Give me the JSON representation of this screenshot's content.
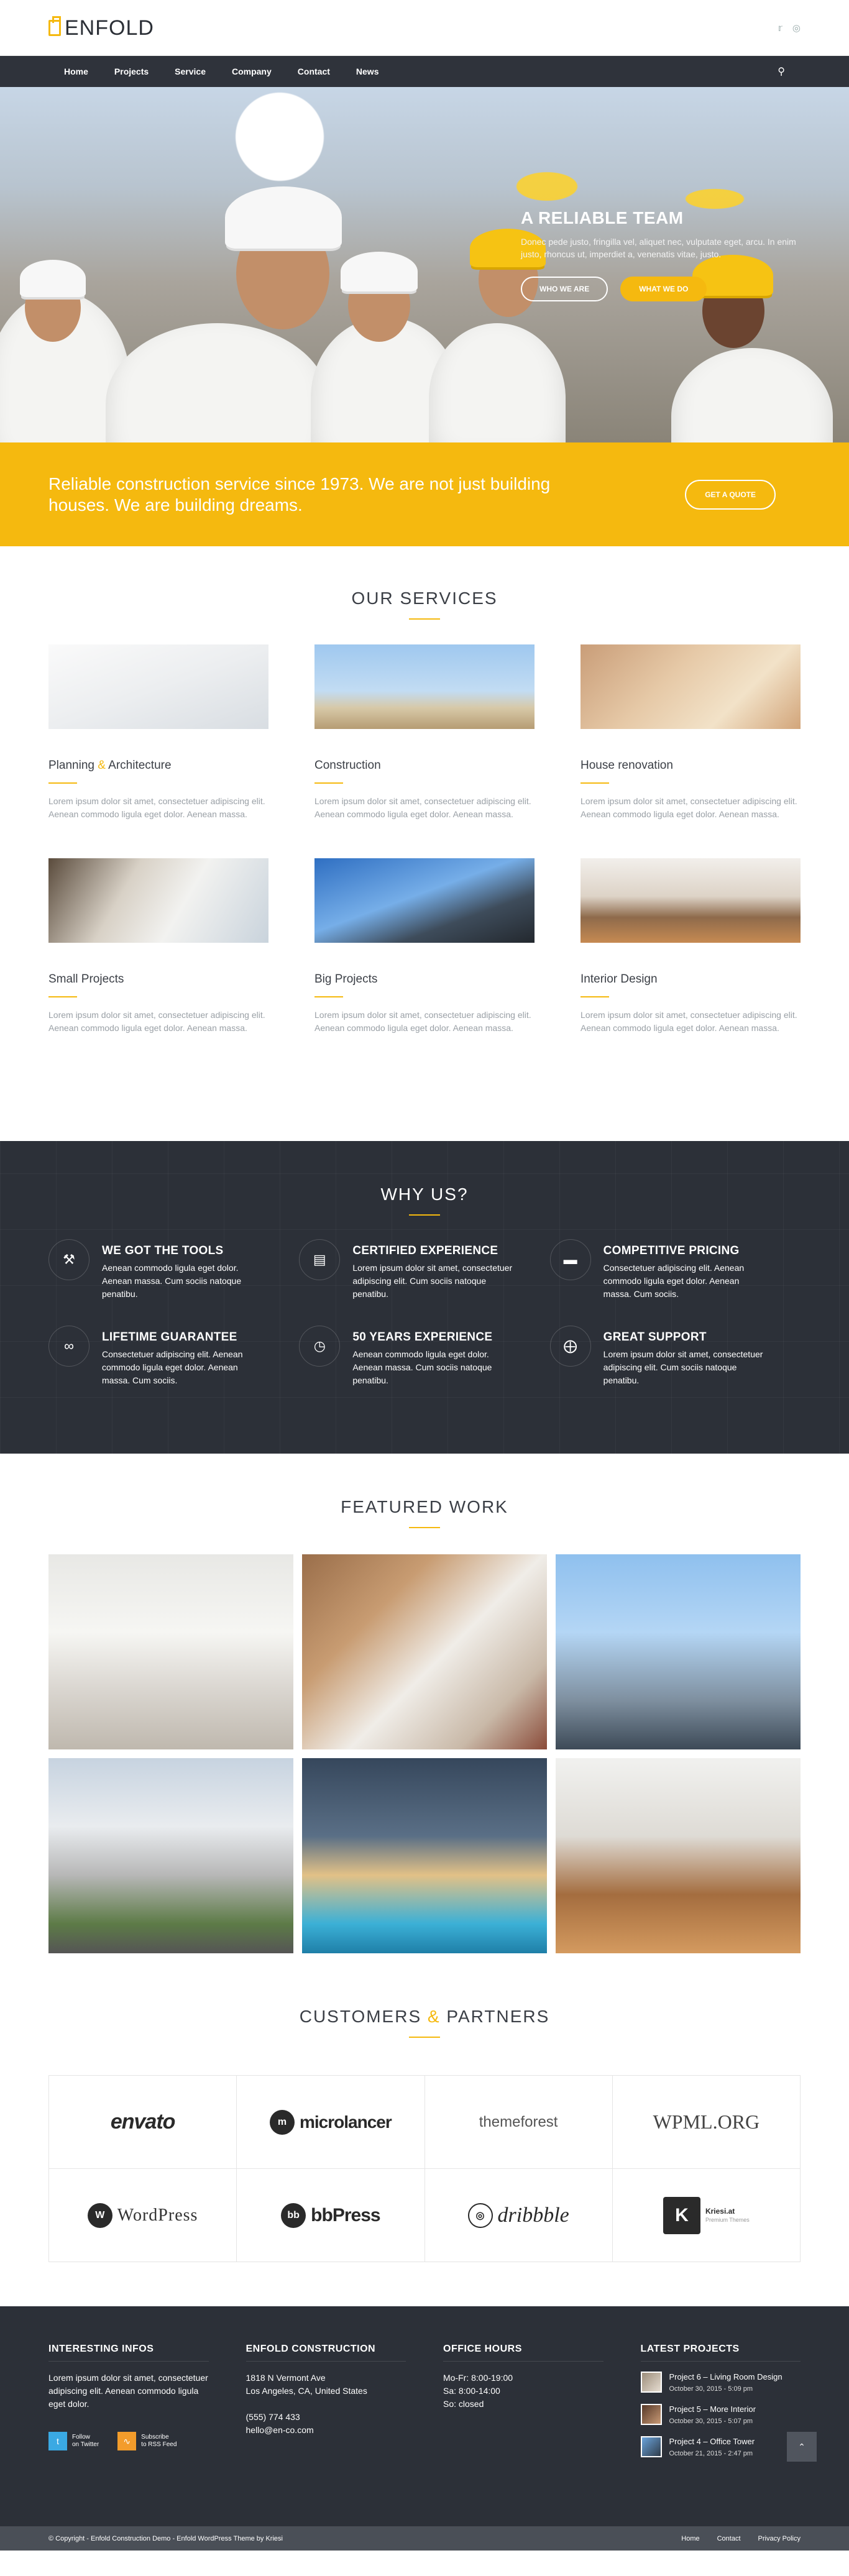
{
  "brand": {
    "name": "ENFOLD"
  },
  "header": {
    "social": [
      "twitter-icon",
      "dribbble-icon"
    ]
  },
  "nav": {
    "items": [
      "Home",
      "Projects",
      "Service",
      "Company",
      "Contact",
      "News"
    ],
    "search_icon": "search-icon"
  },
  "hero": {
    "title": "A RELIABLE TEAM",
    "text": "Donec pede justo, fringilla vel, aliquet nec, vulputate eget, arcu. In enim justo, rhoncus ut, imperdiet a, venenatis vitae, justo.",
    "btn_primary": "WHO WE ARE",
    "btn_secondary": "WHAT WE DO"
  },
  "banner": {
    "text": "Reliable construction service since 1973. We are not just building houses. We are building dreams.",
    "button": "GET A QUOTE"
  },
  "services": {
    "title": "OUR SERVICES",
    "items": [
      {
        "title_a": "Planning",
        "amp": "&",
        "title_b": "Architecture",
        "text": "Lorem ipsum dolor sit amet, consectetuer adipiscing elit. Aenean commodo ligula eget dolor. Aenean massa."
      },
      {
        "title": "Construction",
        "text": "Lorem ipsum dolor sit amet, consectetuer adipiscing elit. Aenean commodo ligula eget dolor. Aenean massa."
      },
      {
        "title": "House renovation",
        "text": "Lorem ipsum dolor sit amet, consectetuer adipiscing elit. Aenean commodo ligula eget dolor. Aenean massa."
      },
      {
        "title": "Small Projects",
        "text": "Lorem ipsum dolor sit amet, consectetuer adipiscing elit. Aenean commodo ligula eget dolor. Aenean massa."
      },
      {
        "title": "Big Projects",
        "text": "Lorem ipsum dolor sit amet, consectetuer adipiscing elit. Aenean commodo ligula eget dolor. Aenean massa."
      },
      {
        "title": "Interior Design",
        "text": "Lorem ipsum dolor sit amet, consectetuer adipiscing elit. Aenean commodo ligula eget dolor. Aenean massa."
      }
    ]
  },
  "why": {
    "title": "WHY US?",
    "items": [
      {
        "icon": "tools-icon",
        "title": "WE GOT THE TOOLS",
        "text": "Aenean commodo ligula eget dolor. Aenean massa. Cum sociis natoque penatibu."
      },
      {
        "icon": "certificate-icon",
        "title": "CERTIFIED EXPERIENCE",
        "text": "Lorem ipsum dolor sit amet, consectetuer adipiscing elit.  Cum sociis natoque penatibu."
      },
      {
        "icon": "credit-card-icon",
        "title": "COMPETITIVE PRICING",
        "text": "Consectetuer adipiscing elit. Aenean commodo ligula eget dolor. Aenean massa. Cum sociis."
      },
      {
        "icon": "infinity-icon",
        "title": "LIFETIME GUARANTEE",
        "text": "Consectetuer adipiscing elit. Aenean commodo ligula eget dolor. Aenean massa. Cum sociis."
      },
      {
        "icon": "clock-icon",
        "title": "50 YEARS EXPERIENCE",
        "text": "Aenean commodo ligula eget dolor. Aenean massa. Cum sociis natoque penatibu."
      },
      {
        "icon": "support-icon",
        "title": "GREAT SUPPORT",
        "text": "Lorem ipsum dolor sit amet, consectetuer adipiscing elit.  Cum sociis natoque penatibu."
      }
    ]
  },
  "featured": {
    "title": "FEATURED WORK"
  },
  "partners": {
    "title_a": "CUSTOMERS",
    "amp": "&",
    "title_b": "PARTNERS",
    "logos": [
      "envato",
      "microlancer",
      "themeforest",
      "WPML.ORG",
      "WordPress",
      "bbPress",
      "dribbble",
      "Kriesi.at"
    ],
    "kriesi_sub": "Premium Themes"
  },
  "footer": {
    "col1": {
      "title": "INTERESTING INFOS",
      "text": "Lorem ipsum dolor sit amet, consectetuer adipiscing elit. Aenean commodo ligula eget dolor.",
      "follow_twitter": "Follow",
      "follow_twitter_sub": "on Twitter",
      "follow_rss": "Subscribe",
      "follow_rss_sub": "to RSS Feed"
    },
    "col2": {
      "title": "ENFOLD CONSTRUCTION",
      "addr1": "1818 N Vermont Ave",
      "addr2": "Los Angeles, CA, United States",
      "phone": "(555) 774 433",
      "email": "hello@en-co.com"
    },
    "col3": {
      "title": "OFFICE HOURS",
      "l1": "Mo-Fr: 8:00-19:00",
      "l2": "Sa: 8:00-14:00",
      "l3": "So: closed"
    },
    "col4": {
      "title": "LATEST PROJECTS",
      "projects": [
        {
          "title": "Project 6 – Living Room Design",
          "date": "October 30, 2015 - 5:09 pm"
        },
        {
          "title": "Project 5 – More Interior",
          "date": "October 30, 2015 - 5:07 pm"
        },
        {
          "title": "Project 4 – Office Tower",
          "date": "October 21, 2015 - 2:47 pm"
        }
      ]
    }
  },
  "socket": {
    "copyright": "© Copyright - Enfold Construction Demo - Enfold WordPress Theme by Kriesi",
    "links": [
      "Home",
      "Contact",
      "Privacy Policy"
    ]
  }
}
